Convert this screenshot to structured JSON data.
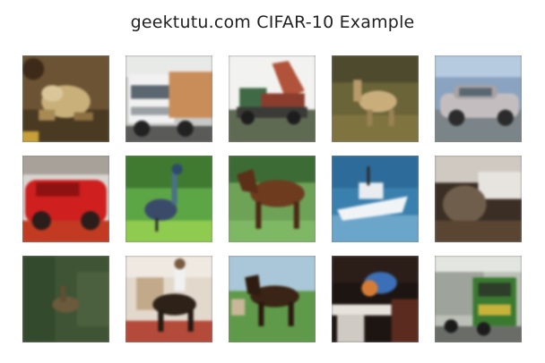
{
  "figure": {
    "title": "geektutu.com CIFAR-10 Example",
    "images": [
      {
        "subject": "frog"
      },
      {
        "subject": "truck"
      },
      {
        "subject": "truck"
      },
      {
        "subject": "deer"
      },
      {
        "subject": "automobile"
      },
      {
        "subject": "automobile"
      },
      {
        "subject": "bird"
      },
      {
        "subject": "horse"
      },
      {
        "subject": "ship"
      },
      {
        "subject": "cat"
      },
      {
        "subject": "deer"
      },
      {
        "subject": "horse"
      },
      {
        "subject": "horse"
      },
      {
        "subject": "bird"
      },
      {
        "subject": "truck"
      }
    ]
  }
}
